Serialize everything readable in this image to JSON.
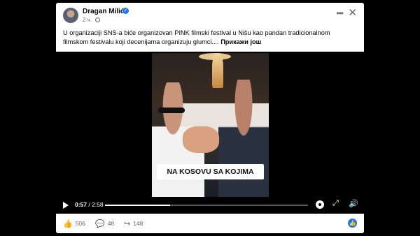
{
  "post": {
    "author": "Dragan Milić",
    "time": "2 ч.",
    "text": "U organizaciji SNS-a biće organizovan PINK filmski festival u Nišu kao pandan tradicionalnom filmskom festivalu koji decenijama organizuju glumci....",
    "see_more": "Прикажи још"
  },
  "video": {
    "caption": "NA KOSOVU SA KOJIMA",
    "current_time": "0:57",
    "duration": "2:58",
    "progress": 0.32
  },
  "stats": {
    "likes": "506",
    "comments": "48",
    "shares": "148"
  },
  "icons": {
    "more": "more-options-icon",
    "close": "close-icon",
    "globe": "globe-icon",
    "play": "play-icon",
    "settings": "gear-icon",
    "fullscreen": "fullscreen-icon",
    "volume": "volume-icon",
    "like": "thumbs-up-icon",
    "comment": "comment-icon",
    "share": "share-icon"
  },
  "colors": {
    "accent": "#1877f2",
    "text": "#050505",
    "muted": "#65676b"
  }
}
